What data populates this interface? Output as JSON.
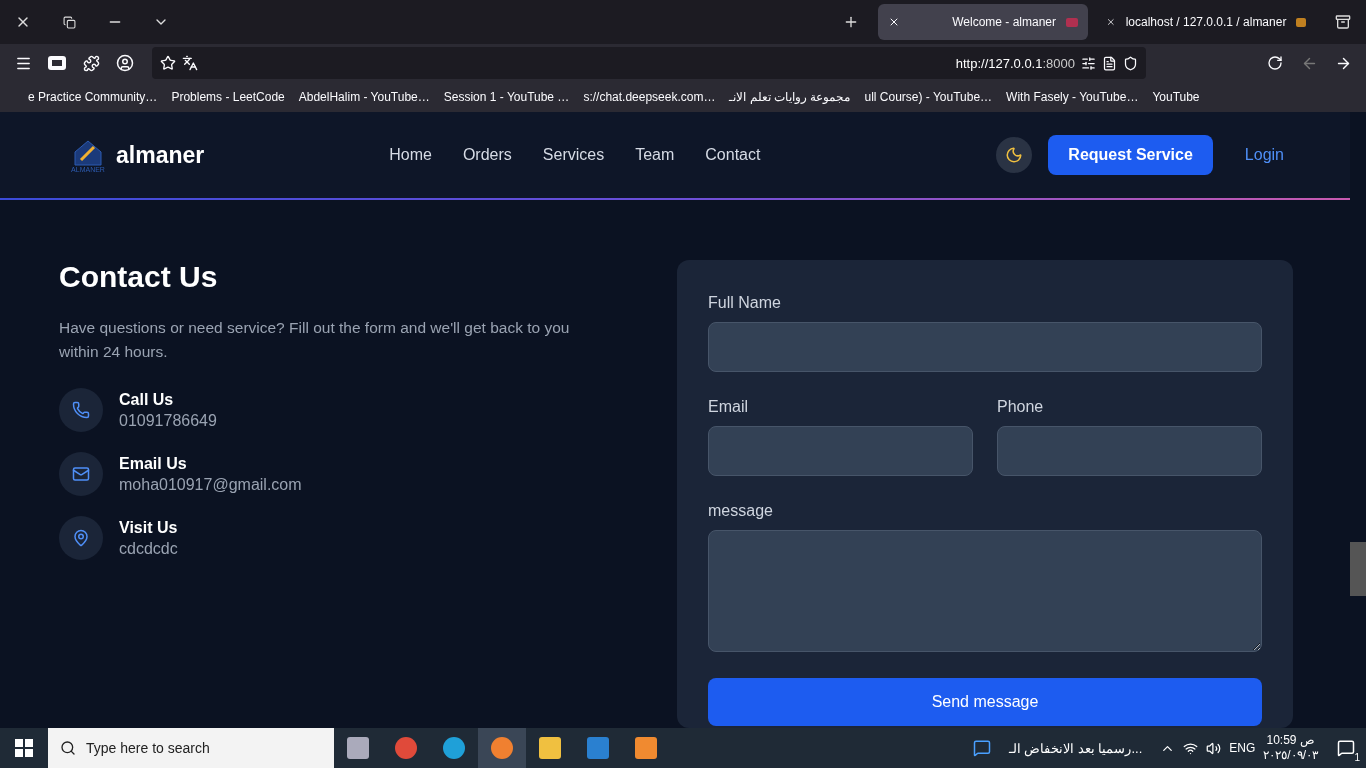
{
  "browser": {
    "tabs": [
      {
        "title": "Welcome - almaner",
        "selected": true
      },
      {
        "title": "localhost / 127.0.0.1 / almaner",
        "selected": false
      }
    ],
    "address": {
      "host": "http://127.0.0.1",
      "port": ":8000"
    },
    "bookmarks": [
      "e Practice Community…",
      "Problems - LeetCode",
      "AbdelHalim - YouTube…",
      "Session 1 - YouTube …",
      "s://chat.deepseek.com…",
      "مجموعة روايات تعلم الانـ",
      "ull Course) - YouTube…",
      "With Fasely - YouTube…",
      "YouTube"
    ]
  },
  "navbar": {
    "logo_caption": "ALMANER",
    "brand": "almaner",
    "links": [
      "Home",
      "Orders",
      "Services",
      "Team",
      "Contact"
    ],
    "cta": "Request Service",
    "login": "Login"
  },
  "contact": {
    "title": "Contact Us",
    "intro": "Have questions or need service? Fill out the form and we'll get back to you within 24 hours.",
    "items": [
      {
        "kind": "phone",
        "label": "Call Us",
        "value": "01091786649"
      },
      {
        "kind": "email",
        "label": "Email Us",
        "value": "moha010917@gmail.com"
      },
      {
        "kind": "location",
        "label": "Visit Us",
        "value": "cdcdcdc"
      }
    ]
  },
  "form": {
    "full_name": "Full Name",
    "email": "Email",
    "phone": "Phone",
    "message": "message",
    "submit": "Send message"
  },
  "taskbar": {
    "search_placeholder": "Type here to search",
    "news": "رسميا بعد الانخفاض الـ...",
    "language": "ENG",
    "time": "10:59",
    "ampm": "ص",
    "date": "٢٠٢٥/٠٩/٠٣",
    "notifications": "1"
  }
}
